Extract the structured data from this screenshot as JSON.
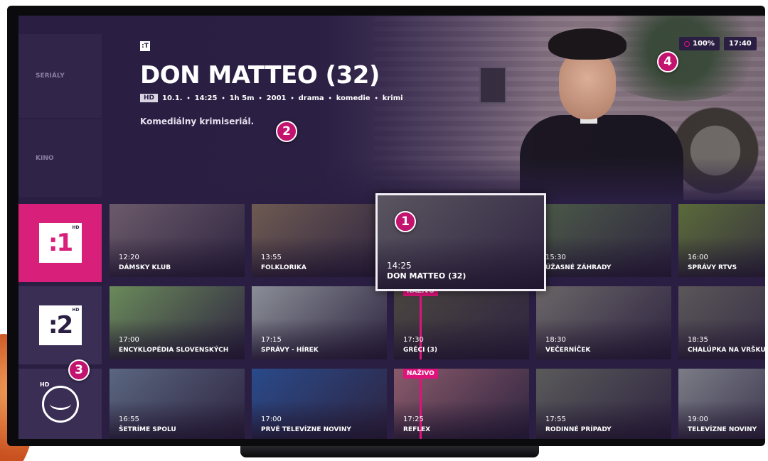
{
  "hero": {
    "channel_logo": ":T",
    "title": "DON MATTEO (32)",
    "hd": "HD",
    "meta": [
      "10.1.",
      "14:25",
      "1h 5m",
      "2001",
      "drama",
      "komedie",
      "krimi"
    ],
    "meta_separator": "•",
    "description": "Komediálny krimiseriál."
  },
  "status": {
    "battery": "100%",
    "clock": "17:40"
  },
  "sidebar": {
    "tabs": [
      {
        "label": "SERIÁLY"
      },
      {
        "label": "KINO"
      }
    ],
    "channels": [
      {
        "logo": ":1",
        "hd": "HD"
      },
      {
        "logo": ":2",
        "hd": "HD"
      },
      {
        "hd": "HD"
      }
    ]
  },
  "live_label": "NAŽIVO",
  "rows": [
    [
      {
        "time": "12:20",
        "title": "DÁMSKY KLUB",
        "bg": "#6b5a6a"
      },
      {
        "time": "13:55",
        "title": "FOLKLORIKA",
        "bg": "#6e5a52"
      },
      {
        "time": "14:25",
        "title": "DON MATTEO (32)",
        "bg": "#5a5560"
      },
      {
        "time": "15:30",
        "title": "ÚŽASNÉ ZÁHRADY",
        "bg": "#4c5a48"
      },
      {
        "time": "16:00",
        "title": "SPRÁVY RTVS",
        "bg": "#5a6a3a"
      }
    ],
    [
      {
        "time": "17:00",
        "title": "ENCYKLOPÉDIA SLOVENSKÝCH",
        "bg": "#6a8a5a"
      },
      {
        "time": "17:15",
        "title": "SPRÁVY - HÍREK",
        "bg": "#8a8e96"
      },
      {
        "time": "17:30",
        "title": "GRÉCI (3)",
        "bg": "#4a4640",
        "live": true
      },
      {
        "time": "18:30",
        "title": "VEČERNÍČEK",
        "bg": "#6a6668"
      },
      {
        "time": "18:35",
        "title": "CHALÚPKA NA VRŠKU",
        "bg": "#5a5658"
      }
    ],
    [
      {
        "time": "16:55",
        "title": "ŠETRÍME SPOLU",
        "bg": "#5a6680"
      },
      {
        "time": "17:00",
        "title": "PRVÉ TELEVÍZNE NOVINY",
        "bg": "#2a4a8a"
      },
      {
        "time": "17:25",
        "title": "REFLEX",
        "bg": "#8a5a6a",
        "live": true
      },
      {
        "time": "17:55",
        "title": "RODINNÉ PRÍPADY",
        "bg": "#5a5a5a"
      },
      {
        "time": "19:00",
        "title": "TELEVÍZNE NOVINY",
        "bg": "#7a7c86"
      }
    ]
  ],
  "callouts": [
    "1",
    "2",
    "3",
    "4"
  ],
  "colors": {
    "accent": "#e0137d",
    "background": "#2a1f42"
  }
}
